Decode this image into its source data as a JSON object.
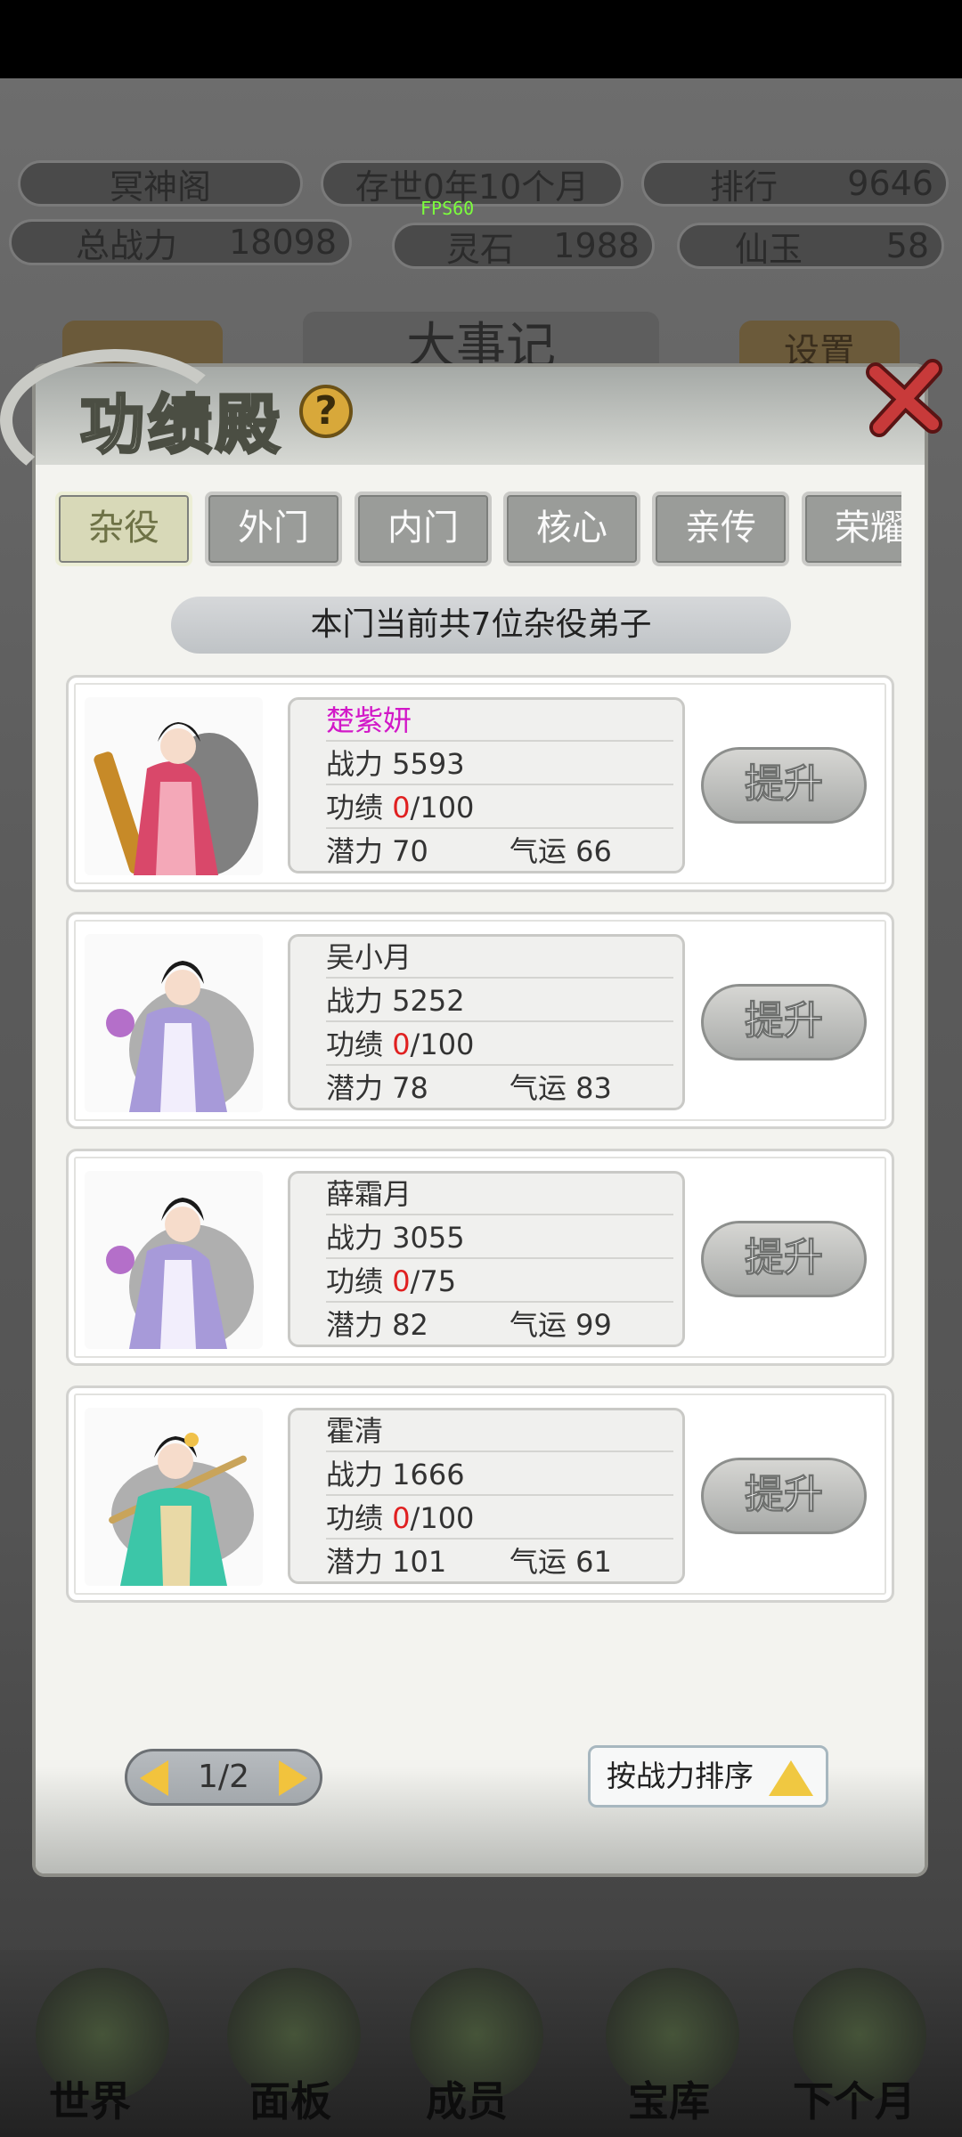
{
  "hud": {
    "sect_name": "冥神阁",
    "time": "存世0年10个月",
    "rank_label": "排行",
    "rank_value": "9646",
    "power_label": "总战力",
    "power_value": "18098",
    "stone_label": "灵石",
    "stone_value": "1988",
    "jade_label": "仙玉",
    "jade_value": "58",
    "fps": "FPS60",
    "events_label": "大事记",
    "settings_label": "设置"
  },
  "modal": {
    "title": "功绩殿",
    "help": "?",
    "tabs": [
      "杂役",
      "外门",
      "内门",
      "核心",
      "亲传",
      "荣耀"
    ],
    "active_tab": "杂役",
    "banner": "本门当前共7位杂役弟子",
    "disciples": [
      {
        "name": "楚紫妍",
        "power": "战力 5593",
        "merit_label": "功绩 ",
        "merit_cur": "0",
        "merit_max": "/100",
        "potential": "潜力 70",
        "luck": "气运 66",
        "button": "提升",
        "name_color": "purple"
      },
      {
        "name": "吴小月",
        "power": "战力 5252",
        "merit_label": "功绩 ",
        "merit_cur": "0",
        "merit_max": "/100",
        "potential": "潜力 78",
        "luck": "气运 83",
        "button": "提升",
        "name_color": "red"
      },
      {
        "name": "薛霜月",
        "power": "战力 3055",
        "merit_label": "功绩 ",
        "merit_cur": "0",
        "merit_max": "/75",
        "potential": "潜力 82",
        "luck": "气运 99",
        "button": "提升",
        "name_color": "red"
      },
      {
        "name": "霍清",
        "power": "战力 1666",
        "merit_label": "功绩 ",
        "merit_cur": "0",
        "merit_max": "/100",
        "potential": "潜力 101",
        "luck": "气运 61",
        "button": "提升",
        "name_color": "red"
      }
    ],
    "pager": "1/2",
    "sort_label": "按战力排序"
  },
  "nav": [
    "世界",
    "面板",
    "成员",
    "宝库",
    "下个月"
  ]
}
